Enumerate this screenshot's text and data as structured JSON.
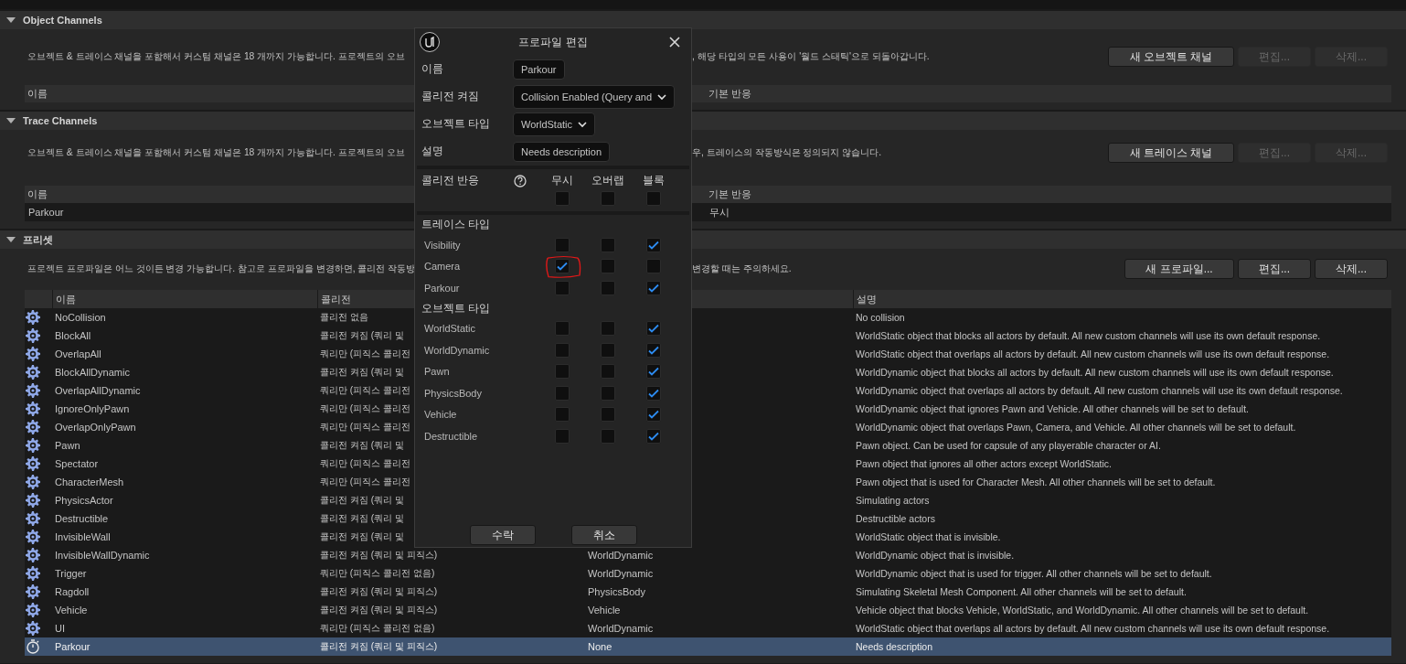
{
  "object_channels": {
    "title": "Object Channels",
    "expanded": true,
    "description": [
      "오브젝트 & 트레이스 채널을 포함해서 커스텀 채널은 18 개까지 가능합니다. 프로젝트의 오브",
      ", 해당 타입의 모든 사용이 '월드 스태틱'으로 되돌아갑니다."
    ],
    "buttons": [
      {
        "label": "새 오브젝트 채널",
        "disabled": false
      },
      {
        "label": "편집...",
        "disabled": true
      },
      {
        "label": "삭제...",
        "disabled": true
      }
    ],
    "columns": [
      "이름",
      "기본 반응"
    ]
  },
  "trace_channels": {
    "title": "Trace Channels",
    "expanded": true,
    "description": [
      "오브젝트 & 트레이스 채널을 포함해서 커스텀 채널은 18 개까지 가능합니다. 프로젝트의 오브",
      "우, 트레이스의 작동방식은 정의되지 않습니다."
    ],
    "buttons": [
      {
        "label": "새 트레이스 채널",
        "disabled": false
      },
      {
        "label": "편집...",
        "disabled": true
      },
      {
        "label": "삭제...",
        "disabled": true
      }
    ],
    "columns": [
      "이름",
      "기본 반응"
    ],
    "rows": [
      {
        "name": "Parkour",
        "default_response": "무시"
      }
    ]
  },
  "presets": {
    "title": "프리셋",
    "expanded": true,
    "description": [
      "프로젝트 프로파일은 어느 것이든 변경 가능합니다. 참고로 프로파일을 변경하면, 콜리전 작동방",
      "변경할 때는 주의하세요."
    ],
    "buttons": [
      {
        "label": "새 프로파일...",
        "disabled": false
      },
      {
        "label": "편집...",
        "disabled": false
      },
      {
        "label": "삭제...",
        "disabled": false
      }
    ],
    "columns": [
      "이름",
      "콜리전",
      "설명"
    ],
    "rows": [
      {
        "kind": "preset",
        "name": "NoCollision",
        "collision": "콜리전 없음",
        "description": "No collision",
        "selected": false
      },
      {
        "kind": "preset",
        "name": "BlockAll",
        "collision": "콜리전 켜짐 (쿼리 및",
        "description": "WorldStatic object that blocks all actors by default. All new custom channels will use its own default response.",
        "selected": false
      },
      {
        "kind": "preset",
        "name": "OverlapAll",
        "collision": "쿼리만 (피직스 콜리전",
        "description": "WorldStatic object that overlaps all actors by default. All new custom channels will use its own default response.",
        "selected": false
      },
      {
        "kind": "preset",
        "name": "BlockAllDynamic",
        "collision": "콜리전 켜짐 (쿼리 및",
        "description": "WorldDynamic object that blocks all actors by default. All new custom channels will use its own default response.",
        "selected": false
      },
      {
        "kind": "preset",
        "name": "OverlapAllDynamic",
        "collision": "쿼리만 (피직스 콜리전",
        "description": "WorldDynamic object that overlaps all actors by default. All new custom channels will use its own default response.",
        "selected": false
      },
      {
        "kind": "preset",
        "name": "IgnoreOnlyPawn",
        "collision": "쿼리만 (피직스 콜리전",
        "description": "WorldDynamic object that ignores Pawn and Vehicle. All other channels will be set to default.",
        "selected": false
      },
      {
        "kind": "preset",
        "name": "OverlapOnlyPawn",
        "collision": "쿼리만 (피직스 콜리전",
        "description": "WorldDynamic object that overlaps Pawn, Camera, and Vehicle. All other channels will be set to default.",
        "selected": false
      },
      {
        "kind": "preset",
        "name": "Pawn",
        "collision": "콜리전 켜짐 (쿼리 및",
        "description": "Pawn object. Can be used for capsule of any playerable character or AI.",
        "selected": false
      },
      {
        "kind": "preset",
        "name": "Spectator",
        "collision": "쿼리만 (피직스 콜리전",
        "description": "Pawn object that ignores all other actors except WorldStatic.",
        "selected": false
      },
      {
        "kind": "preset",
        "name": "CharacterMesh",
        "collision": "쿼리만 (피직스 콜리전",
        "description": "Pawn object that is used for Character Mesh. All other channels will be set to default.",
        "selected": false
      },
      {
        "kind": "preset",
        "name": "PhysicsActor",
        "collision": "콜리전 켜짐 (쿼리 및",
        "description": "Simulating actors",
        "selected": false
      },
      {
        "kind": "preset",
        "name": "Destructible",
        "collision": "콜리전 켜짐 (쿼리 및",
        "description": "Destructible actors",
        "selected": false
      },
      {
        "kind": "preset",
        "name": "InvisibleWall",
        "collision": "콜리전 켜짐 (쿼리 및",
        "description": "WorldStatic object that is invisible.",
        "selected": false
      },
      {
        "kind": "preset",
        "name": "InvisibleWallDynamic",
        "collision": "콜리전 켜짐 (쿼리 및 피직스)",
        "object_type": "WorldDynamic",
        "description": "WorldDynamic object that is invisible.",
        "selected": false
      },
      {
        "kind": "preset",
        "name": "Trigger",
        "collision": "쿼리만 (피직스 콜리전 없음)",
        "object_type": "WorldDynamic",
        "description": "WorldDynamic object that is used for trigger. All other channels will be set to default.",
        "selected": false
      },
      {
        "kind": "preset",
        "name": "Ragdoll",
        "collision": "콜리전 켜짐 (쿼리 및 피직스)",
        "object_type": "PhysicsBody",
        "description": "Simulating Skeletal Mesh Component. All other channels will be set to default.",
        "selected": false
      },
      {
        "kind": "preset",
        "name": "Vehicle",
        "collision": "콜리전 켜짐 (쿼리 및 피직스)",
        "object_type": "Vehicle",
        "description": "Vehicle object that blocks Vehicle, WorldStatic, and WorldDynamic. All other channels will be set to default.",
        "selected": false
      },
      {
        "kind": "preset",
        "name": "UI",
        "collision": "쿼리만 (피직스 콜리전 없음)",
        "object_type": "WorldDynamic",
        "description": "WorldStatic object that overlaps all actors by default. All new custom channels will use its own default response.",
        "selected": false
      },
      {
        "kind": "custom",
        "name": "Parkour",
        "collision": "콜리전 켜짐 (쿼리 및 피직스)",
        "object_type": "None",
        "description": "Needs description",
        "selected": true
      }
    ]
  },
  "modal": {
    "title": "프로파일 편집",
    "fields": [
      {
        "label": "이름",
        "kind": "text",
        "value": "Parkour"
      },
      {
        "label": "콜리전 켜짐",
        "kind": "dropdown",
        "value": "Collision Enabled (Query and"
      },
      {
        "label": "오브젝트 타입",
        "kind": "dropdown",
        "value": "WorldStatic"
      },
      {
        "label": "설명",
        "kind": "text",
        "value": "Needs description"
      }
    ],
    "response_label": "콜리전 반응",
    "response_columns": [
      "무시",
      "오버랩",
      "블록"
    ],
    "all_responses": [
      {
        "checked": false
      },
      {
        "checked": false
      },
      {
        "checked": false
      }
    ],
    "groups": [
      {
        "title": "트레이스 타입",
        "rows": [
          {
            "name": "Visibility",
            "responses": [
              {
                "checked": false
              },
              {
                "checked": false
              },
              {
                "checked": true
              }
            ]
          },
          {
            "name": "Camera",
            "responses": [
              {
                "checked": true
              },
              {
                "checked": false
              },
              {
                "checked": false
              }
            ]
          },
          {
            "name": "Parkour",
            "responses": [
              {
                "checked": false
              },
              {
                "checked": false
              },
              {
                "checked": true
              }
            ]
          }
        ]
      },
      {
        "title": "오브젝트 타입",
        "rows": [
          {
            "name": "WorldStatic",
            "responses": [
              {
                "checked": false
              },
              {
                "checked": false
              },
              {
                "checked": true
              }
            ]
          },
          {
            "name": "WorldDynamic",
            "responses": [
              {
                "checked": false
              },
              {
                "checked": false
              },
              {
                "checked": true
              }
            ]
          },
          {
            "name": "Pawn",
            "responses": [
              {
                "checked": false
              },
              {
                "checked": false
              },
              {
                "checked": true
              }
            ]
          },
          {
            "name": "PhysicsBody",
            "responses": [
              {
                "checked": false
              },
              {
                "checked": false
              },
              {
                "checked": true
              }
            ]
          },
          {
            "name": "Vehicle",
            "responses": [
              {
                "checked": false
              },
              {
                "checked": false
              },
              {
                "checked": true
              }
            ]
          },
          {
            "name": "Destructible",
            "responses": [
              {
                "checked": false
              },
              {
                "checked": false
              },
              {
                "checked": true
              }
            ]
          }
        ]
      }
    ],
    "buttons": [
      "수락",
      "취소"
    ]
  }
}
